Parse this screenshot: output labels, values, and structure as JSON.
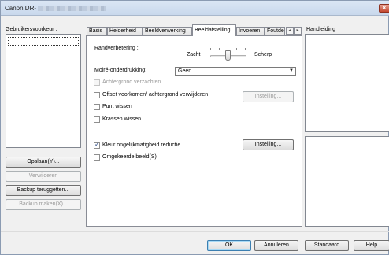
{
  "window": {
    "title": "Canon DR-"
  },
  "left_panel": {
    "label": "Gebruikersvoorkeur :",
    "buttons": {
      "save": "Opslaan(Y)...",
      "delete": "Verwijderen",
      "backup_restore": "Backup teruggetten...",
      "backup_make": "Backup maken(X)..."
    }
  },
  "tabs": [
    {
      "label": "Basis"
    },
    {
      "label": "Helderheid"
    },
    {
      "label": "Beeldverwerking"
    },
    {
      "label": "Beeldafstelling"
    },
    {
      "label": "Invoeren"
    },
    {
      "label": "Foutde"
    }
  ],
  "tab_scroll": {
    "left": "◂",
    "right": "▸"
  },
  "edge": {
    "label": "Randverbetering :",
    "min_label": "Zacht",
    "max_label": "Scherp"
  },
  "moire": {
    "label": "Moiré-onderdrukking:",
    "selected": "Geen",
    "arrow": "▼"
  },
  "options": {
    "background_smoothing": "Achtergrond verzachten",
    "offset_removal": "Offset voorkomen/ achtergrond verwijderen",
    "offset_settings": "Instelling...",
    "dot_removal": "Punt wissen",
    "scratch_removal": "Krassen wissen",
    "color_drift": "Kleur ongelijkmatigheid reductie",
    "color_drift_settings": "Instelling...",
    "invert": "Omgekeerde beeld(S)"
  },
  "right_panel": {
    "label": "Handleiding"
  },
  "footer": {
    "ok": "OK",
    "cancel": "Annuleren",
    "default": "Standaard",
    "help": "Help"
  },
  "colors": {
    "title_bar": "#c9d8ec",
    "close_button": "#c3472f",
    "dialog_bg": "#f0f0f0",
    "check_mark": "#2b4a86"
  }
}
